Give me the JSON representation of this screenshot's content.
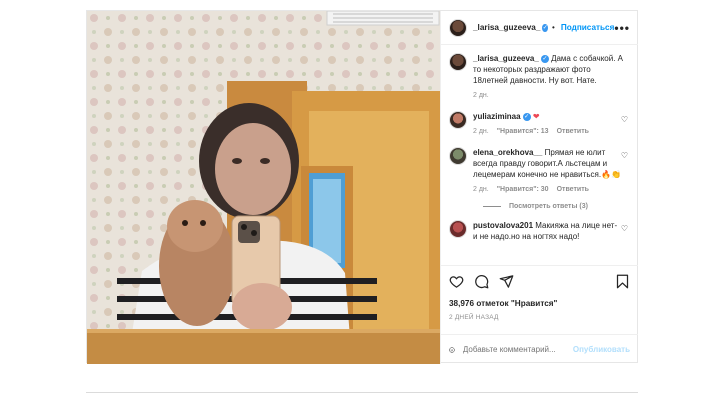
{
  "post": {
    "username": "_larisa_guzeeva_",
    "follow_label": "Подписаться",
    "more_label": "•••",
    "caption_user": "_larisa_guzeeva_",
    "caption_text": "Дама с собачкой. А то некоторых раздражают фото 18летней давности. Ну вот. Нате.",
    "caption_time": "2 дн."
  },
  "comments": [
    {
      "user": "yuliaziminaa",
      "text": "",
      "time": "2 дн.",
      "likes": "\"Нравится\": 13",
      "reply": "Ответить"
    },
    {
      "user": "elena_orekhova__",
      "text": "Прямая не юлит всегда правду говорит.А льстецам и лецемерам конечно не нравиться.🔥👏",
      "time": "2 дн.",
      "likes": "\"Нравится\": 30",
      "reply": "Ответить"
    },
    {
      "user": "pustovalova201",
      "text": "Макияжа на лице нет- и не надо.но на ногтях надо!"
    }
  ],
  "view_replies": "Посмотреть ответы (3)",
  "likes_text": "38,976 отметок \"Нравится\"",
  "date_text": "2 ДНЕЙ НАЗАД",
  "add_comment": {
    "placeholder": "Добавьте комментарий...",
    "publish_label": "Опубликовать"
  },
  "icons": {
    "like": "heart-icon",
    "comment": "comment-icon",
    "share": "share-icon",
    "save": "bookmark-icon",
    "emoji": "emoji-icon"
  },
  "colors": {
    "link_blue": "#0095f6",
    "verified_blue": "#3897f0",
    "heart_red": "#ed4956",
    "publish_disabled": "#b2dffc"
  }
}
